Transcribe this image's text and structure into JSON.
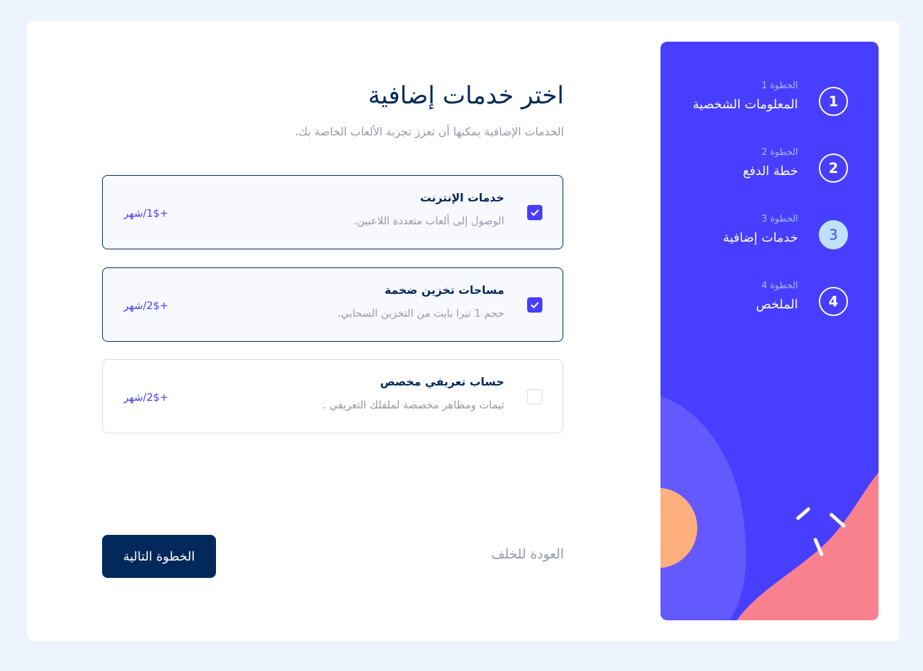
{
  "steps": [
    {
      "number": "1",
      "label": "الخطوة 1",
      "title": "المعلومات الشخصية",
      "active": false
    },
    {
      "number": "2",
      "label": "الخطوة 2",
      "title": "خطة الدفع",
      "active": false
    },
    {
      "number": "3",
      "label": "الخطوة 3",
      "title": "خدمات إضافية",
      "active": true
    },
    {
      "number": "4",
      "label": "الخطوة 4",
      "title": "الملخص",
      "active": false
    }
  ],
  "main": {
    "title": "اختر خدمات إضافية",
    "subtitle": "الخدمات الإضافية يمكنها أن تعزز تجربة الألعاب الخاصة بك."
  },
  "addons": [
    {
      "name": "خدمات الإنترنت",
      "description": "الوصول إلى ألعاب متعددة اللاعبين.",
      "price": "+1$/شهر",
      "checked": true
    },
    {
      "name": "مساحات تخزين ضخمة",
      "description": "حجم 1 تيرا بايت من التخزين السحابي.",
      "price": "+2$/شهر",
      "checked": true
    },
    {
      "name": "حساب تعريفي مخصص",
      "description": "ثيمات ومظاهر مخصصة لملفلك التعريفي .",
      "price": "+2$/شهر",
      "checked": false
    }
  ],
  "footer": {
    "back_label": "العودة للخلف",
    "next_label": "الخطوة التالية"
  },
  "colors": {
    "sidebar": "#483eff",
    "active_step": "#bee2fd",
    "primary_text": "#022959",
    "muted_text": "#9699aa",
    "accent": "#483eff",
    "page_bg": "#eef4fe"
  },
  "icons": {
    "checkbox": "checkmark-icon"
  }
}
